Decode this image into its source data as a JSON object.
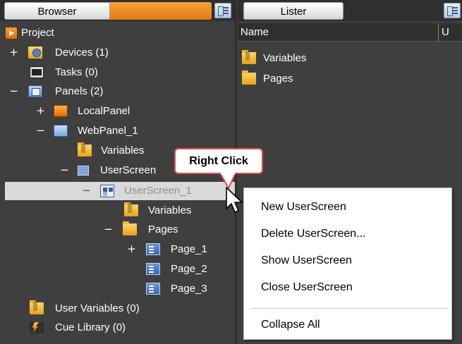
{
  "browser": {
    "tab_label": "Browser",
    "tree": [
      {
        "label": "Project",
        "icon": "project-icon"
      },
      {
        "label": "Devices (1)",
        "expander": "+",
        "icon": "devices-folder-icon"
      },
      {
        "label": "Tasks (0)",
        "icon": "tasks-icon"
      },
      {
        "label": "Panels (2)",
        "expander": "−",
        "icon": "panels-icon"
      },
      {
        "label": "LocalPanel",
        "expander": "+",
        "icon": "local-panel-icon"
      },
      {
        "label": "WebPanel_1",
        "expander": "−",
        "icon": "web-panel-icon"
      },
      {
        "label": "Variables",
        "icon": "variables-folder-icon"
      },
      {
        "label": "UserScreen",
        "expander": "−",
        "icon": "userscreens-icon"
      },
      {
        "label": "UserScreen_1",
        "expander": "−",
        "icon": "userscreen-icon",
        "selected": true
      },
      {
        "label": "Variables",
        "icon": "variables-folder-icon"
      },
      {
        "label": "Pages",
        "expander": "−",
        "icon": "pages-folder-icon"
      },
      {
        "label": "Page_1",
        "expander": "+",
        "icon": "page-icon"
      },
      {
        "label": "Page_2",
        "icon": "page-icon"
      },
      {
        "label": "Page_3",
        "icon": "page-icon"
      },
      {
        "label": "User Variables (0)",
        "icon": "user-variables-folder-icon"
      },
      {
        "label": "Cue Library (0)",
        "icon": "cue-library-icon"
      }
    ]
  },
  "lister": {
    "tab_label": "Lister",
    "columns": {
      "name": "Name",
      "u": "U"
    },
    "items": [
      {
        "label": "Variables",
        "icon": "variables-folder-icon"
      },
      {
        "label": "Pages",
        "icon": "pages-folder-icon"
      }
    ]
  },
  "callout": {
    "text": "Right Click"
  },
  "context_menu": {
    "items": [
      "New UserScreen",
      "Delete UserScreen...",
      "Show UserScreen",
      "Close UserScreen",
      "Collapse All"
    ]
  },
  "colors": {
    "background": "#3f3f3f",
    "accent_orange": "#e27a12",
    "callout_border": "#e04d4d",
    "selection": "#d9d9d9"
  }
}
